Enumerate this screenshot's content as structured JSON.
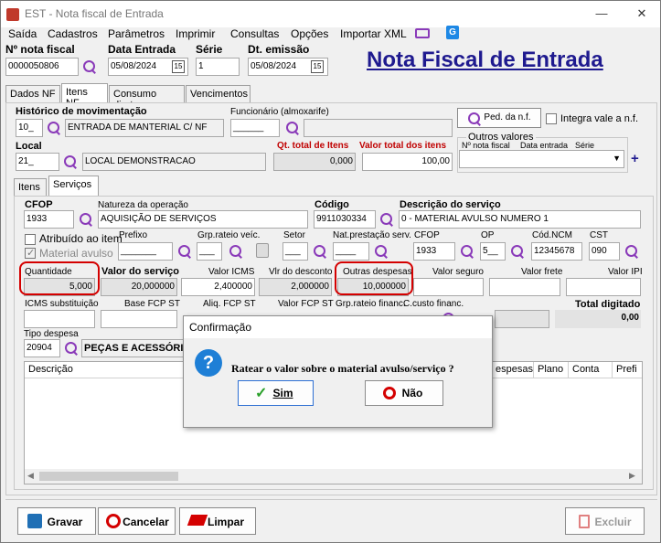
{
  "window": {
    "title": "EST - Nota fiscal de Entrada",
    "minimize": "—",
    "close": "✕"
  },
  "menu": [
    "Saída",
    "Cadastros",
    "Parâmetros",
    "Imprimir",
    "Consultas",
    "Opções",
    "Importar XML"
  ],
  "header": {
    "nf_label": "Nº nota fiscal",
    "nf_value": "0000050806",
    "data_entrada_label": "Data Entrada",
    "data_entrada_value": "05/08/2024",
    "serie_label": "Série",
    "serie_value": "1",
    "dt_emissao_label": "Dt. emissão",
    "dt_emissao_value": "05/08/2024",
    "big_title": "Nota Fiscal de Entrada",
    "cal_icon": "15"
  },
  "tabs": [
    "Dados NF",
    "Itens NF",
    "Consumo direto",
    "Vencimentos"
  ],
  "itens_nf": {
    "historico_label": "Histórico de movimentação",
    "historico_code": "10_",
    "historico_desc": "ENTRADA DE MANTERIAL C/ NF",
    "funcionario_label": "Funcionário (almoxarife)",
    "funcionario_code": "______",
    "funcionario_desc": "",
    "ped_button": "Ped. da n.f.",
    "integra_label": "Integra vale a n.f.",
    "local_label": "Local",
    "local_code": "21_",
    "local_desc": "LOCAL DEMONSTRACAO",
    "qt_total_label": "Qt. total de Itens",
    "qt_total_value": "0,000",
    "valor_total_label": "Valor total dos itens",
    "valor_total_value": "100,00",
    "outros_valores_label": "Outros valores",
    "outros_cols": [
      "Nº nota fiscal",
      "Data entrada",
      "Série"
    ],
    "plus": "+"
  },
  "subtabs": [
    "Itens",
    "Serviços"
  ],
  "servicos": {
    "cfop_label": "CFOP",
    "cfop_value": "1933",
    "natureza_label": "Natureza da operação",
    "natureza_value": "AQUISIÇÃO DE SERVIÇOS",
    "codigo_label": "Código",
    "codigo_value": "9911030334",
    "descricao_label": "Descrição do serviço",
    "descricao_value": "0 - MATERIAL AVULSO NUMERO 1",
    "atribuido_label": "Atribuído ao item",
    "material_avulso_label": "Material avulso",
    "prefixo_label": "Prefixo",
    "prefixo_value": "_______",
    "grp_rateio_label": "Grp.rateio veíc.",
    "grp_rateio_value": "___",
    "setor_label": "Setor",
    "setor_value": "___",
    "nat_prest_label": "Nat.prestação serv.",
    "nat_prest_value": "____",
    "cfop2_label": "CFOP",
    "cfop2_value": "1933",
    "op_label": "OP",
    "op_value": "5__",
    "cod_ncm_label": "Cód.NCM",
    "cod_ncm_value": "12345678",
    "cst_label": "CST",
    "cst_value": "090",
    "quantidade_label": "Quantidade",
    "quantidade_value": "5,000",
    "valor_servico_label": "Valor do serviço",
    "valor_servico_value": "20,000000",
    "valor_icms_label": "Valor ICMS",
    "valor_icms_value": "2,400000",
    "vlr_desconto_label": "Vlr do desconto",
    "vlr_desconto_value": "2,000000",
    "outras_despesas_label": "Outras despesas",
    "outras_despesas_value": "10,000000",
    "valor_seguro_label": "Valor seguro",
    "valor_frete_label": "Valor frete",
    "valor_ipi_label": "Valor IPI",
    "icms_subst_label": "ICMS substituição",
    "base_fcp_label": "Base FCP ST",
    "aliq_fcp_label": "Aliq. FCP ST",
    "valor_fcp_label": "Valor FCP ST",
    "grp_rateio_financ_label": "Grp.rateio financ.",
    "c_custo_label": "C.custo financ.",
    "total_digitado_label": "Total digitado",
    "total_digitado_value": "0,00",
    "tipo_despesa_label": "Tipo despesa",
    "tipo_despesa_code": "20904",
    "tipo_despesa_desc": "PEÇAS E ACESSÓRIOS",
    "grid_cols": [
      "Descrição",
      "espesas",
      "Plano",
      "Conta",
      "Prefi"
    ]
  },
  "dialog": {
    "title": "Confirmação",
    "message": "Ratear o valor sobre o material avulso/serviço ?",
    "yes": "Sim",
    "no": "Não"
  },
  "footer": {
    "gravar": "Gravar",
    "cancelar": "Cancelar",
    "limpar": "Limpar",
    "excluir": "Excluir"
  },
  "colors": {
    "accent_title": "#1f1a8f",
    "red_label": "#c00000",
    "purple_icon": "#8a3ab9"
  }
}
